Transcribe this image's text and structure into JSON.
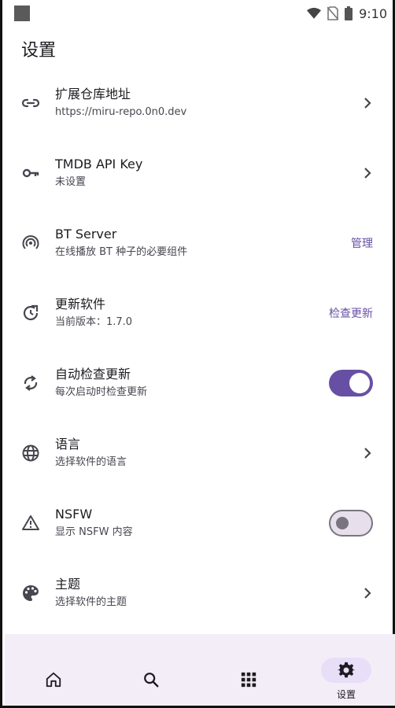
{
  "status_bar": {
    "time": "9:10",
    "icons": [
      "wifi-icon",
      "no-sim-icon",
      "battery-icon"
    ]
  },
  "page": {
    "title": "设置"
  },
  "settings": [
    {
      "icon": "link-icon",
      "title": "扩展仓库地址",
      "subtitle": "https://miru-repo.0n0.dev",
      "trailing": "chevron"
    },
    {
      "icon": "key-icon",
      "title": "TMDB API Key",
      "subtitle": "未设置",
      "trailing": "chevron"
    },
    {
      "icon": "broadcast-icon",
      "title": "BT Server",
      "subtitle": "在线播放 BT 种子的必要组件",
      "trailing": "action",
      "action_label": "管理"
    },
    {
      "icon": "update-icon",
      "title": "更新软件",
      "subtitle": "当前版本：1.7.0",
      "trailing": "action",
      "action_label": "检查更新"
    },
    {
      "icon": "sync-icon",
      "title": "自动检查更新",
      "subtitle": "每次启动时检查更新",
      "trailing": "switch",
      "switch_on": true
    },
    {
      "icon": "globe-icon",
      "title": "语言",
      "subtitle": "选择软件的语言",
      "trailing": "chevron"
    },
    {
      "icon": "warning-icon",
      "title": "NSFW",
      "subtitle": "显示 NSFW 内容",
      "trailing": "switch",
      "switch_on": false
    },
    {
      "icon": "palette-icon",
      "title": "主题",
      "subtitle": "选择软件的主题",
      "trailing": "chevron"
    }
  ],
  "bottom_nav": {
    "items": [
      {
        "icon": "home-icon",
        "label": ""
      },
      {
        "icon": "search-icon",
        "label": ""
      },
      {
        "icon": "apps-grid-icon",
        "label": ""
      },
      {
        "icon": "gear-icon",
        "label": "设置",
        "active": true
      }
    ]
  },
  "colors": {
    "accent": "#6750a4",
    "nav_background": "#f3edf7",
    "active_indicator": "#e8def8"
  }
}
